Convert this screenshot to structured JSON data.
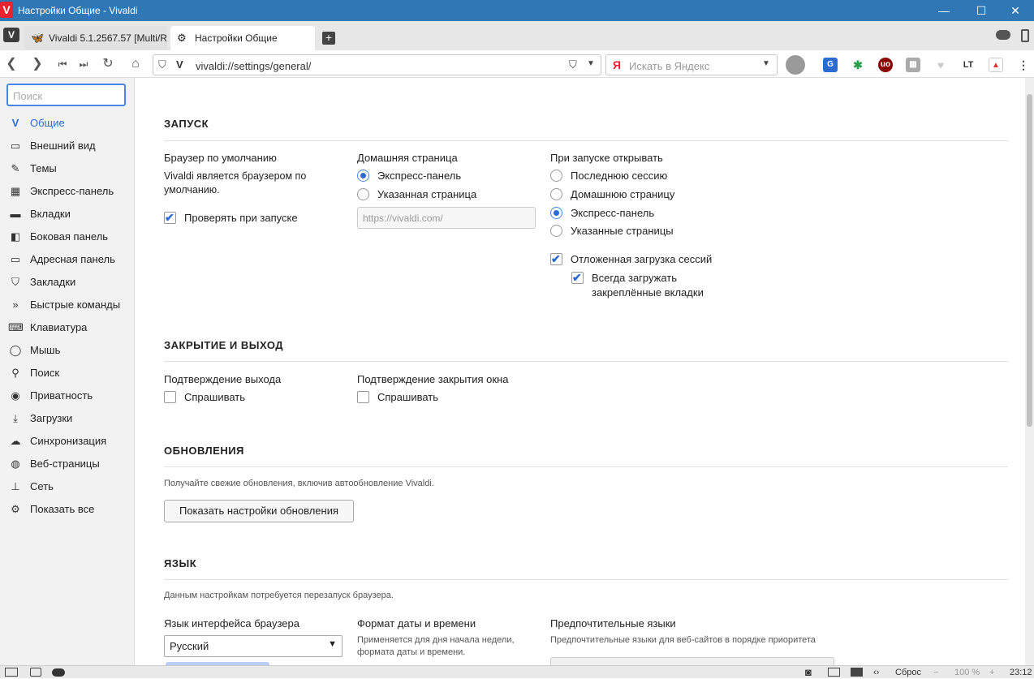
{
  "window": {
    "title": "Настройки Общие - Vivaldi",
    "logo": "V",
    "controls": {
      "minimize": "—",
      "maximize": "☐",
      "close": "✕"
    }
  },
  "tabs": [
    {
      "label": "Vivaldi 5.1.2567.57 [Multi/R",
      "icon": "butterfly-icon"
    },
    {
      "label": "Настройки Общие",
      "icon": "gear-icon"
    }
  ],
  "toolbar": {
    "url": "vivaldi://settings/general/",
    "search_placeholder": "Искать в Яндекс",
    "search_engine_letter": "Я"
  },
  "sidebar": {
    "search_placeholder": "Поиск",
    "items": [
      {
        "label": "Общие",
        "icon": "vivaldi-icon",
        "active": true
      },
      {
        "label": "Внешний вид",
        "icon": "window-icon"
      },
      {
        "label": "Темы",
        "icon": "brush-icon"
      },
      {
        "label": "Экспресс-панель",
        "icon": "grid-icon"
      },
      {
        "label": "Вкладки",
        "icon": "tabs-icon"
      },
      {
        "label": "Боковая панель",
        "icon": "panel-icon"
      },
      {
        "label": "Адресная панель",
        "icon": "addressbar-icon"
      },
      {
        "label": "Закладки",
        "icon": "bookmark-icon"
      },
      {
        "label": "Быстрые команды",
        "icon": "quick-commands-icon"
      },
      {
        "label": "Клавиатура",
        "icon": "keyboard-icon"
      },
      {
        "label": "Мышь",
        "icon": "mouse-icon"
      },
      {
        "label": "Поиск",
        "icon": "search-icon"
      },
      {
        "label": "Приватность",
        "icon": "eye-icon"
      },
      {
        "label": "Загрузки",
        "icon": "download-icon"
      },
      {
        "label": "Синхронизация",
        "icon": "cloud-icon"
      },
      {
        "label": "Веб-страницы",
        "icon": "globe-icon"
      },
      {
        "label": "Сеть",
        "icon": "network-icon"
      },
      {
        "label": "Показать все",
        "icon": "gear-icon"
      }
    ]
  },
  "startup": {
    "heading": "ЗАПУСК",
    "default_browser": {
      "label": "Браузер по умолчанию",
      "status_line1": "Vivaldi является браузером по",
      "status_line2": "умолчанию.",
      "check_label": "Проверять при запуске",
      "checked": true
    },
    "homepage": {
      "label": "Домашняя страница",
      "opt1": "Экспресс-панель",
      "opt2": "Указанная страница",
      "selected": "Экспресс-панель",
      "url_placeholder": "https://vivaldi.com/"
    },
    "on_start": {
      "label": "При запуске открывать",
      "opt1": "Последнюю сессию",
      "opt2": "Домашнюю страницу",
      "opt3": "Экспресс-панель",
      "opt4": "Указанные страницы",
      "selected": "Экспресс-панель",
      "lazy_load": "Отложенная загрузка сессий",
      "always_load_line1": "Всегда загружать",
      "always_load_line2": "закреплённые вкладки"
    }
  },
  "closing": {
    "heading": "ЗАКРЫТИЕ И ВЫХОД",
    "exit_label": "Подтверждение выхода",
    "exit_check": "Спрашивать",
    "window_label": "Подтверждение закрытия окна",
    "window_check": "Спрашивать"
  },
  "updates": {
    "heading": "ОБНОВЛЕНИЯ",
    "hint": "Получайте свежие обновления, включив автообновление Vivaldi.",
    "button": "Показать настройки обновления"
  },
  "language": {
    "heading": "ЯЗЫК",
    "hint": "Данным настройкам потребуется перезапуск браузера.",
    "ui_lang_label": "Язык интерфейса браузера",
    "ui_lang_value": "Русский",
    "datetime_label": "Формат даты и времени",
    "datetime_hint_line1": "Применяется для дня начала недели,",
    "datetime_hint_line2": "формата даты и времени.",
    "preferred_label": "Предпочтительные языки",
    "preferred_hint": "Предпочтительные языки для веб-сайтов в порядке приоритета"
  },
  "statusbar": {
    "reset": "Сброс",
    "zoom": "100 %",
    "time": "23:12"
  }
}
